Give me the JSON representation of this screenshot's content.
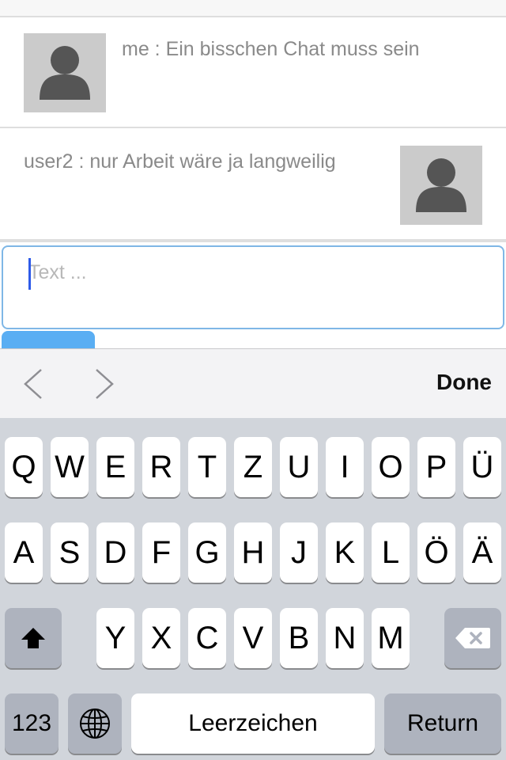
{
  "messages": [
    {
      "text": "me : Ein bisschen Chat muss sein",
      "avatar": "user-silhouette-icon",
      "side": "left"
    },
    {
      "text": "user2 : nur Arbeit wäre ja langweilig",
      "avatar": "user-silhouette-icon",
      "side": "right"
    }
  ],
  "input": {
    "placeholder": "Text ...",
    "value": ""
  },
  "toolbar": {
    "prev_icon": "chevron-left-icon",
    "next_icon": "chevron-right-icon",
    "done_label": "Done"
  },
  "keyboard": {
    "row1": [
      "Q",
      "W",
      "E",
      "R",
      "T",
      "Z",
      "U",
      "I",
      "O",
      "P",
      "Ü"
    ],
    "row2": [
      "A",
      "S",
      "D",
      "F",
      "G",
      "H",
      "J",
      "K",
      "L",
      "Ö",
      "Ä"
    ],
    "row3": [
      "Y",
      "X",
      "C",
      "V",
      "B",
      "N",
      "M"
    ],
    "numbers_label": "123",
    "space_label": "Leerzeichen",
    "return_label": "Return",
    "shift_icon": "shift-icon",
    "globe_icon": "globe-icon",
    "delete_icon": "backspace-icon"
  },
  "colors": {
    "accent": "#5aaef3",
    "input_border": "#7fb7e6",
    "caret": "#2e5be8",
    "keyboard_bg": "#d1d5db"
  }
}
